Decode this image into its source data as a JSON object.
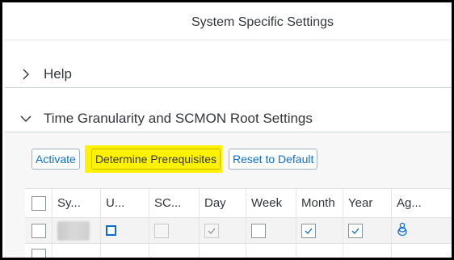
{
  "dialog": {
    "title": "System Specific Settings"
  },
  "panels": {
    "help": {
      "title": "Help",
      "expanded": false
    },
    "time": {
      "title": "Time Granularity and SCMON Root Settings",
      "expanded": true
    }
  },
  "toolbar": {
    "activate_label": "Activate",
    "determine_label": "Determine Prerequisites",
    "reset_label": "Reset to Default",
    "highlight_color": "#fff200"
  },
  "table": {
    "columns": [
      "Sy...",
      "U...",
      "SC...",
      "Day",
      "Week",
      "Month",
      "Year",
      "Ag..."
    ],
    "rows": [
      {
        "selected": false,
        "system": "",
        "u": "unchecked-editable",
        "sc": "unchecked-disabled",
        "day": true,
        "week": false,
        "month": true,
        "year": true,
        "ag_icon": "person-icon"
      }
    ]
  },
  "colors": {
    "accent": "#0a6ed1",
    "text": "#32363a"
  }
}
